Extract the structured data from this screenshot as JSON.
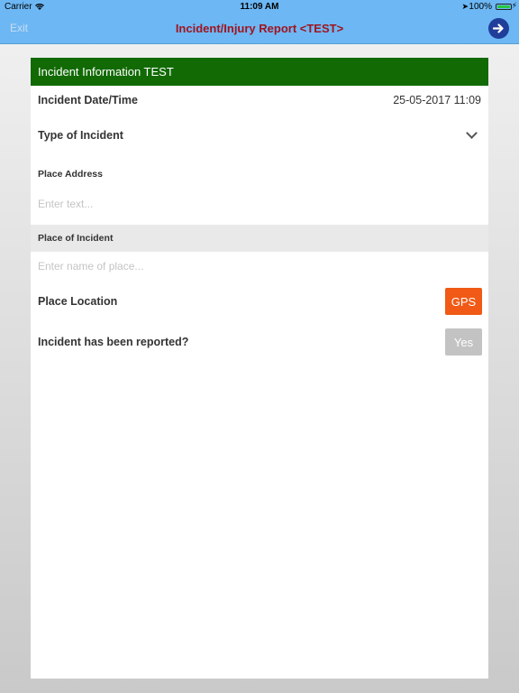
{
  "status_bar": {
    "carrier": "Carrier",
    "wifi_icon": "wifi-icon",
    "time": "11:09 AM",
    "location_icon": "location-arrow-icon",
    "battery_percent": "100%",
    "battery_level": 1.0,
    "charging_icon": "bolt-icon"
  },
  "nav": {
    "exit_label": "Exit",
    "title": "Incident/Injury Report <TEST>",
    "next_icon": "arrow-right-circle-icon"
  },
  "form": {
    "header": "Incident Information TEST",
    "date_label": "Incident Date/Time",
    "date_value": "25-05-2017 11:09",
    "type_label": "Type of Incident",
    "address_label": "Place Address",
    "address_placeholder": "Enter text...",
    "place_label": "Place of Incident",
    "place_placeholder": "Enter name of place...",
    "location_label": "Place Location",
    "gps_button": "GPS",
    "reported_label": "Incident has been reported?",
    "reported_value": "Yes"
  },
  "colors": {
    "nav_bg": "#6cb7f4",
    "title": "#a0141e",
    "header_bg": "#126a05",
    "gps_button": "#f05a16",
    "yes_button": "#c3c3c3",
    "next_button": "#1f3e9a"
  }
}
